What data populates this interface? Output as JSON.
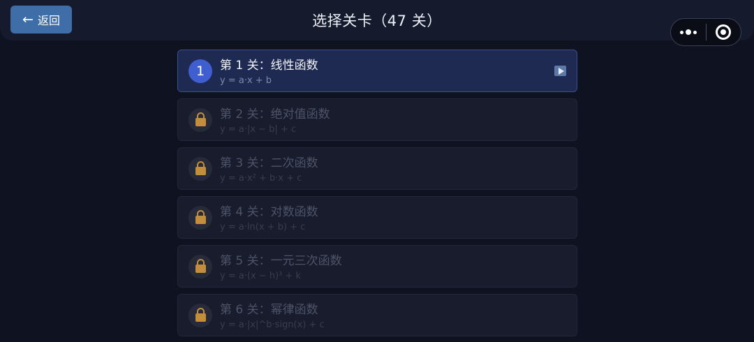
{
  "header": {
    "back_label": "返回",
    "back_arrow": "←",
    "title": "选择关卡（47 关）"
  },
  "capsule": {
    "more_icon": "more-dots-icon",
    "close_icon": "target-icon"
  },
  "colors": {
    "background": "#0f1220",
    "accent": "#3f5fd1",
    "back_button": "#3f6da7",
    "lock": "#c28e3c"
  },
  "levels": [
    {
      "badge": "1",
      "name": "第 1 关：线性函数",
      "formula": "y = a·x + b",
      "locked": false,
      "icon": "play-icon"
    },
    {
      "badge": "",
      "name": "第 2 关：绝对值函数",
      "formula": "y = a·|x − b| + c",
      "locked": true,
      "icon": "lock-icon"
    },
    {
      "badge": "",
      "name": "第 3 关：二次函数",
      "formula": "y = a·x² + b·x + c",
      "locked": true,
      "icon": "lock-icon"
    },
    {
      "badge": "",
      "name": "第 4 关：对数函数",
      "formula": "y = a·ln(x + b) + c",
      "locked": true,
      "icon": "lock-icon"
    },
    {
      "badge": "",
      "name": "第 5 关：一元三次函数",
      "formula": "y = a·(x − h)³ + k",
      "locked": true,
      "icon": "lock-icon"
    },
    {
      "badge": "",
      "name": "第 6 关：幂律函数",
      "formula": "y = a·|x|^b·sign(x) + c",
      "locked": true,
      "icon": "lock-icon"
    }
  ]
}
